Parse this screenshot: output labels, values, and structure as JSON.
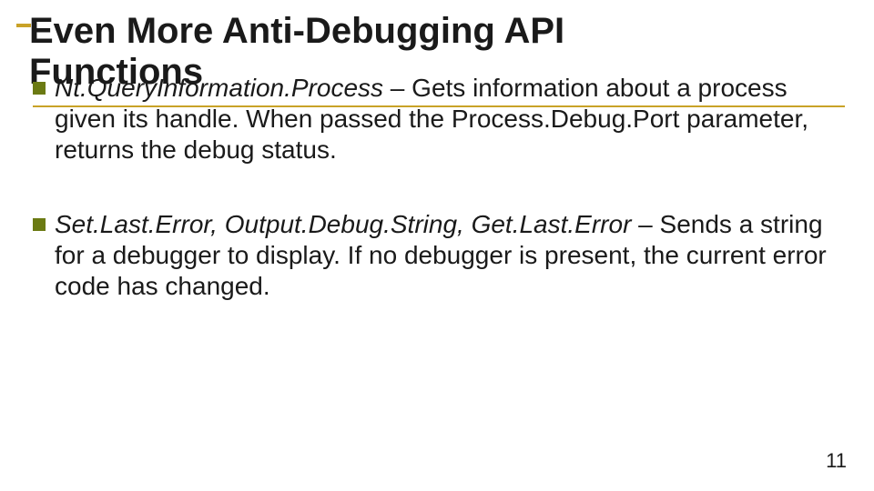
{
  "slide": {
    "title_line1": "Even More Anti-Debugging API",
    "title_line2": "Functions",
    "bullets": [
      {
        "em": "Nt.QueryInformation.Process",
        "rest": " – Gets information about a process given its handle. When passed the Process.Debug.Port parameter, returns the debug status."
      },
      {
        "em": "Set.Last.Error, Output.Debug.String, Get.Last.Error",
        "rest": " – Sends a string for a debugger to display. If no debugger is present, the current error code has changed."
      }
    ],
    "page_number": "11"
  }
}
